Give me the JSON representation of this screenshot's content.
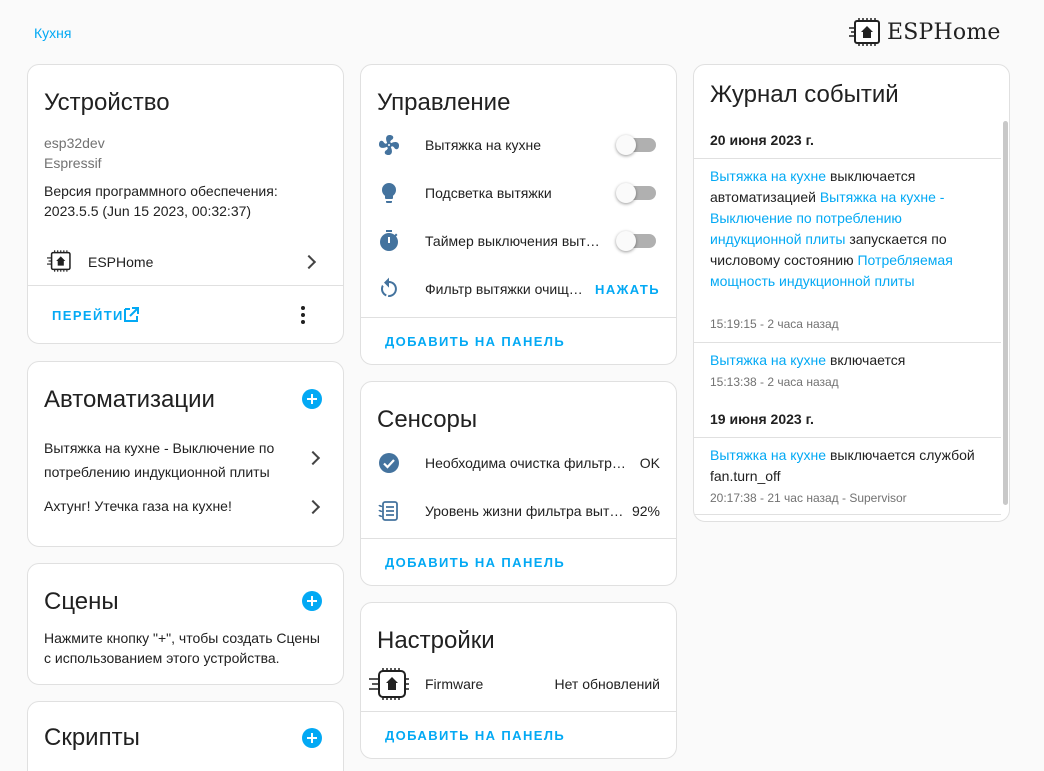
{
  "breadcrumb": {
    "area": "Кухня"
  },
  "brand": {
    "name": "ESPHome"
  },
  "device": {
    "title": "Устройство",
    "model": "esp32dev",
    "manufacturer": "Espressif",
    "firmware_label": "Версия программного обеспечения:",
    "firmware_value": "2023.5.5 (Jun 15 2023, 00:32:37)",
    "integration": "ESPHome",
    "visit_label": "ПЕРЕЙТИ"
  },
  "automations": {
    "title": "Автоматизации",
    "items": [
      {
        "label": "Вытяжка на кухне - Выключение по потреблению индукционной плиты"
      },
      {
        "label": "Ахтунг! Утечка газа на кухне!"
      }
    ]
  },
  "scenes": {
    "title": "Сцены",
    "hint": "Нажмите кнопку \"+\", чтобы создать Сцены с использованием этого устройства."
  },
  "scripts": {
    "title": "Скрипты"
  },
  "controls": {
    "title": "Управление",
    "items": [
      {
        "label": "Вытяжка на кухне",
        "icon": "fan-icon",
        "control": "toggle",
        "state": "off"
      },
      {
        "label": "Подсветка вытяжки",
        "icon": "lightbulb-icon",
        "control": "toggle",
        "state": "off"
      },
      {
        "label": "Таймер выключения выт…",
        "icon": "timer-icon",
        "control": "toggle",
        "state": "off"
      },
      {
        "label": "Фильтр вытяжки очищ…",
        "icon": "restart-icon",
        "control": "button",
        "action": "НАЖАТЬ"
      }
    ],
    "add_label": "ДОБАВИТЬ НА ПАНЕЛЬ"
  },
  "sensors": {
    "title": "Сенсоры",
    "items": [
      {
        "label": "Необходима очистка фильтра…",
        "icon": "check-circle-icon",
        "state": "OK"
      },
      {
        "label": "Уровень жизни фильтра выт…",
        "icon": "air-filter-icon",
        "state": "92%"
      }
    ],
    "add_label": "ДОБАВИТЬ НА ПАНЕЛЬ"
  },
  "config": {
    "title": "Настройки",
    "items": [
      {
        "label": "Firmware",
        "icon": "esphome-chip-icon",
        "state": "Нет обновлений"
      }
    ],
    "add_label": "ДОБАВИТЬ НА ПАНЕЛЬ"
  },
  "logbook": {
    "title": "Журнал событий",
    "groups": [
      {
        "date": "20 июня 2023 г.",
        "entries": [
          {
            "parts": [
              {
                "text": "Вытяжка на кухне",
                "link": true
              },
              {
                "text": " выключается автоматизацией",
                "link": false
              },
              {
                "text": " Вытяжка на кухне - Выключение по потреблению индукционной плиты",
                "link": true
              },
              {
                "text": " запускается по числовому состоянию ",
                "link": false
              },
              {
                "text": "Потребляемая мощность индукционной плиты",
                "link": true
              }
            ],
            "time": "15:19:15 - 2 часа назад"
          },
          {
            "parts": [
              {
                "text": "Вытяжка на кухне",
                "link": true
              },
              {
                "text": " включается",
                "link": false
              }
            ],
            "time": "15:13:38 - 2 часа назад"
          }
        ]
      },
      {
        "date": "19 июня 2023 г.",
        "entries": [
          {
            "parts": [
              {
                "text": "Вытяжка на кухне",
                "link": true
              },
              {
                "text": " выключается службой fan.turn_off",
                "link": false
              }
            ],
            "time": "20:17:38 - 21 час назад - Supervisor"
          }
        ]
      }
    ]
  },
  "colors": {
    "accent": "#03a9f4",
    "icon": "#44739e",
    "text": "#212121",
    "muted": "#727272"
  }
}
